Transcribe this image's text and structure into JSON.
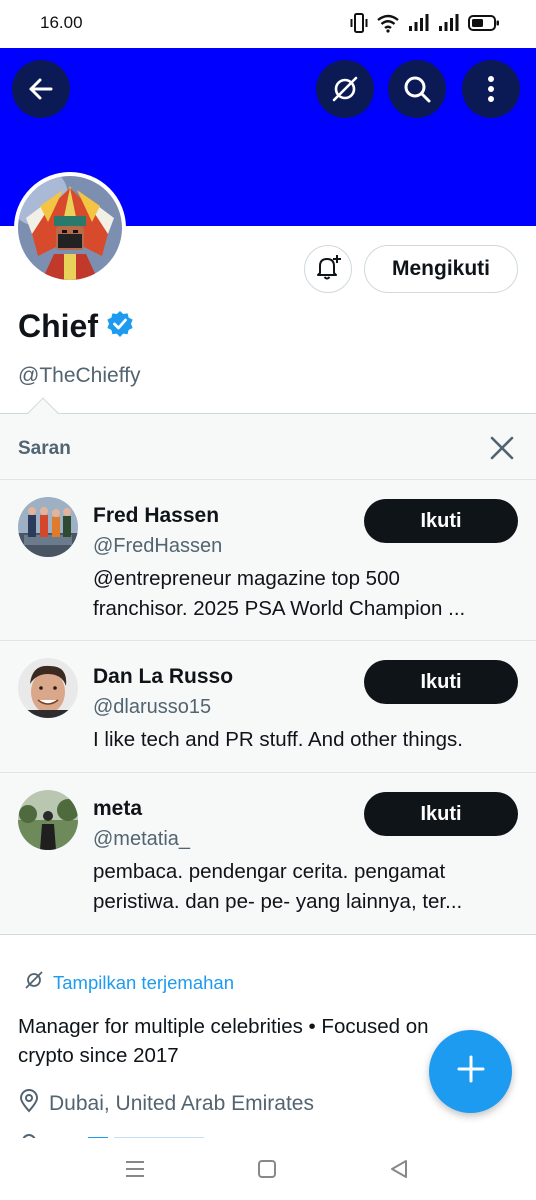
{
  "status_bar": {
    "time": "16.00",
    "icons": [
      "vibrate-icon",
      "wifi-icon",
      "signal-icon",
      "signal-icon",
      "battery-icon"
    ]
  },
  "colors": {
    "banner": "#0000ff",
    "banner_button": "#0b1a55",
    "accent": "#1d9bf0",
    "follow_button": "#0f1419",
    "panel_background": "#f7f9f9",
    "muted_text": "#536471"
  },
  "header": {
    "back_icon": "arrow-left-icon",
    "translate_icon": "translate-icon",
    "search_icon": "search-icon",
    "more_icon": "more-vertical-icon"
  },
  "profile": {
    "name": "Chief",
    "handle": "@TheChieffy",
    "verified": true,
    "follow_state_label": "Mengikuti",
    "notify_icon": "bell-plus-icon"
  },
  "suggestions": {
    "title": "Saran",
    "items": [
      {
        "name": "Fred Hassen",
        "handle": "@FredHassen",
        "bio_lines": [
          "@entrepreneur magazine top 500",
          "franchisor.  2025 PSA World Champion ..."
        ],
        "button_label": "Ikuti"
      },
      {
        "name": "Dan La Russo",
        "handle": "@dlarusso15",
        "bio_lines": [
          "I like tech and PR stuff.  And other things."
        ],
        "button_label": "Ikuti"
      },
      {
        "name": "meta",
        "handle": "@metatia_",
        "bio_lines": [
          "pembaca. pendengar cerita. pengamat",
          "peristiwa. dan pe- pe- yang lainnya, ter..."
        ],
        "button_label": "Ikuti"
      }
    ]
  },
  "bio": {
    "translate_label": "Tampilkan terjemahan",
    "lines": [
      "Manager for multiple celebrities • Focused on",
      "crypto since 2017"
    ],
    "location": "Dubai, United Arab Emirates"
  },
  "fab": {
    "icon": "plus-icon"
  },
  "nav_bar": {
    "icons": [
      "menu-icon",
      "home-square-icon",
      "back-triangle-icon"
    ]
  }
}
